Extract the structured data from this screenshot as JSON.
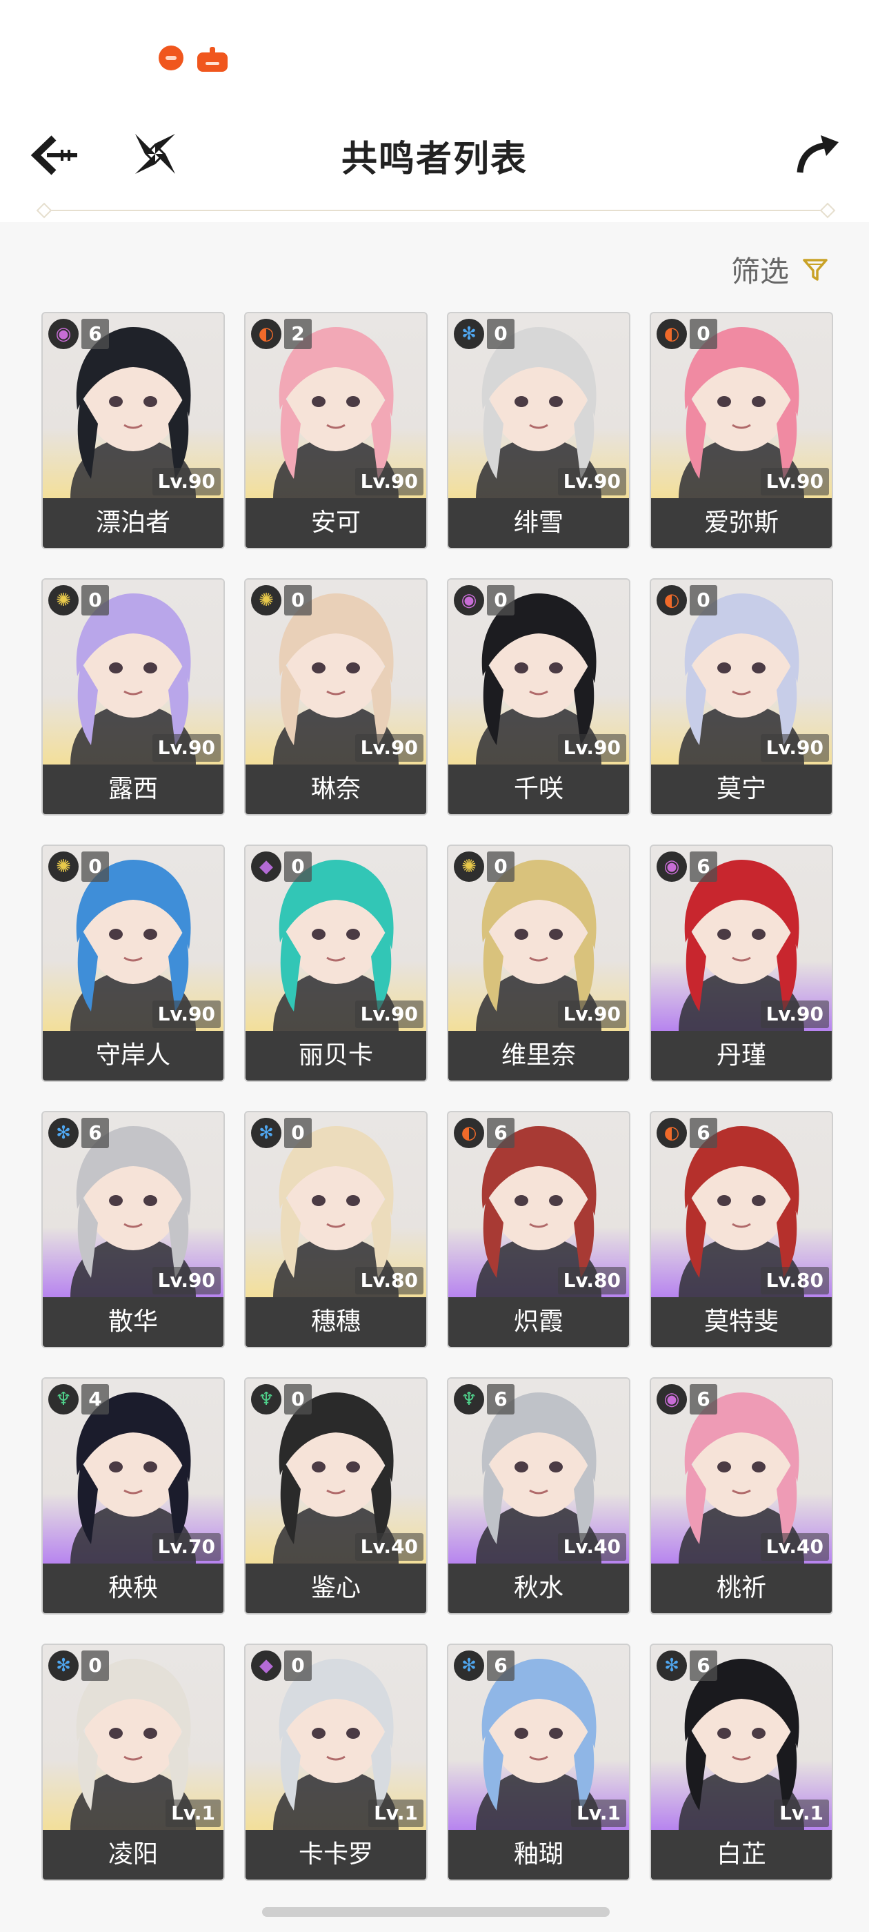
{
  "header": {
    "title": "共鸣者列表"
  },
  "filter": {
    "label": "筛选"
  },
  "colors": {
    "electro": "#c86dd6",
    "fusion": "#f06a2a",
    "glacio": "#4fa6ef",
    "spectro": "#e8c94b",
    "havoc": "#b46bd6",
    "aero": "#4fd18b"
  },
  "characters": [
    {
      "name": "漂泊者",
      "level": "Lv.90",
      "chain": "6",
      "element": "electro",
      "rarity": 5,
      "hair": "#1f2229"
    },
    {
      "name": "安可",
      "level": "Lv.90",
      "chain": "2",
      "element": "fusion",
      "rarity": 5,
      "hair": "#f2a8b6"
    },
    {
      "name": "绯雪",
      "level": "Lv.90",
      "chain": "0",
      "element": "glacio",
      "rarity": 5,
      "hair": "#d7d7d7"
    },
    {
      "name": "爱弥斯",
      "level": "Lv.90",
      "chain": "0",
      "element": "fusion",
      "rarity": 5,
      "hair": "#f08aa2"
    },
    {
      "name": "露西",
      "level": "Lv.90",
      "chain": "0",
      "element": "spectro",
      "rarity": 5,
      "hair": "#b9a6ea"
    },
    {
      "name": "琳奈",
      "level": "Lv.90",
      "chain": "0",
      "element": "spectro",
      "rarity": 5,
      "hair": "#e9d0b8"
    },
    {
      "name": "千咲",
      "level": "Lv.90",
      "chain": "0",
      "element": "electro",
      "rarity": 5,
      "hair": "#1c1c20"
    },
    {
      "name": "莫宁",
      "level": "Lv.90",
      "chain": "0",
      "element": "fusion",
      "rarity": 5,
      "hair": "#c7cde8"
    },
    {
      "name": "守岸人",
      "level": "Lv.90",
      "chain": "0",
      "element": "spectro",
      "rarity": 5,
      "hair": "#3f8ed8"
    },
    {
      "name": "丽贝卡",
      "level": "Lv.90",
      "chain": "0",
      "element": "havoc",
      "rarity": 5,
      "hair": "#32c6b6"
    },
    {
      "name": "维里奈",
      "level": "Lv.90",
      "chain": "0",
      "element": "spectro",
      "rarity": 5,
      "hair": "#d9c27c"
    },
    {
      "name": "丹瑾",
      "level": "Lv.90",
      "chain": "6",
      "element": "electro",
      "rarity": 4,
      "hair": "#c8262e"
    },
    {
      "name": "散华",
      "level": "Lv.90",
      "chain": "6",
      "element": "glacio",
      "rarity": 4,
      "hair": "#c4c4c8"
    },
    {
      "name": "穗穗",
      "level": "Lv.80",
      "chain": "0",
      "element": "glacio",
      "rarity": 5,
      "hair": "#ecdcbc"
    },
    {
      "name": "炽霞",
      "level": "Lv.80",
      "chain": "6",
      "element": "fusion",
      "rarity": 4,
      "hair": "#a83a34"
    },
    {
      "name": "莫特斐",
      "level": "Lv.80",
      "chain": "6",
      "element": "fusion",
      "rarity": 4,
      "hair": "#b5302c"
    },
    {
      "name": "秧秧",
      "level": "Lv.70",
      "chain": "4",
      "element": "aero",
      "rarity": 4,
      "hair": "#1b1c2c"
    },
    {
      "name": "鉴心",
      "level": "Lv.40",
      "chain": "0",
      "element": "aero",
      "rarity": 5,
      "hair": "#2a2a2a"
    },
    {
      "name": "秋水",
      "level": "Lv.40",
      "chain": "6",
      "element": "aero",
      "rarity": 4,
      "hair": "#bfc2c8"
    },
    {
      "name": "桃祈",
      "level": "Lv.40",
      "chain": "6",
      "element": "electro",
      "rarity": 4,
      "hair": "#ee9bb5"
    },
    {
      "name": "凌阳",
      "level": "Lv.1",
      "chain": "0",
      "element": "glacio",
      "rarity": 5,
      "hair": "#e4e0d8"
    },
    {
      "name": "卡卡罗",
      "level": "Lv.1",
      "chain": "0",
      "element": "havoc",
      "rarity": 5,
      "hair": "#d7dbe0"
    },
    {
      "name": "釉瑚",
      "level": "Lv.1",
      "chain": "6",
      "element": "glacio",
      "rarity": 4,
      "hair": "#8fb6e6"
    },
    {
      "name": "白芷",
      "level": "Lv.1",
      "chain": "6",
      "element": "glacio",
      "rarity": 4,
      "hair": "#1a1a1e"
    }
  ]
}
